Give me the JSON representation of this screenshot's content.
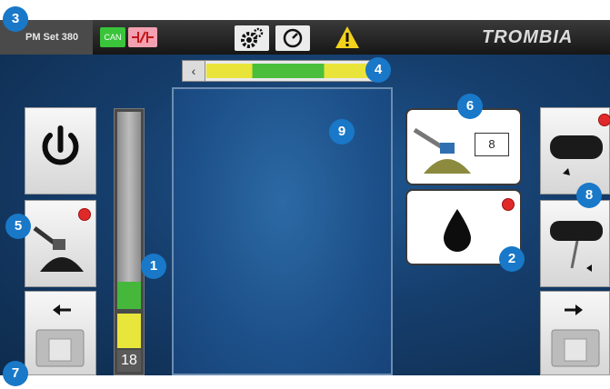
{
  "topbar": {
    "rpm_label": "PM Set 380",
    "can_label": "CAN",
    "brand": "TROMBIA"
  },
  "gauge": {
    "value": "18"
  },
  "tool_card": {
    "value": "8"
  },
  "callouts": [
    "1",
    "2",
    "3",
    "4",
    "5",
    "6",
    "7",
    "8",
    "9"
  ],
  "icons": {
    "power": "power-icon",
    "gear": "settings-gears-icon",
    "gauge": "speedometer-icon",
    "warning": "warning-icon",
    "oil": "oil-drop-icon",
    "arrow_left": "arrow-left-icon",
    "arrow_right": "arrow-right-icon"
  },
  "colors": {
    "background": "#163f6e",
    "accent_blue": "#1978c8",
    "green": "#45b83b",
    "yellow": "#e8e63a",
    "alert_red": "#e02a2a",
    "warning_yellow": "#f2d21b"
  }
}
